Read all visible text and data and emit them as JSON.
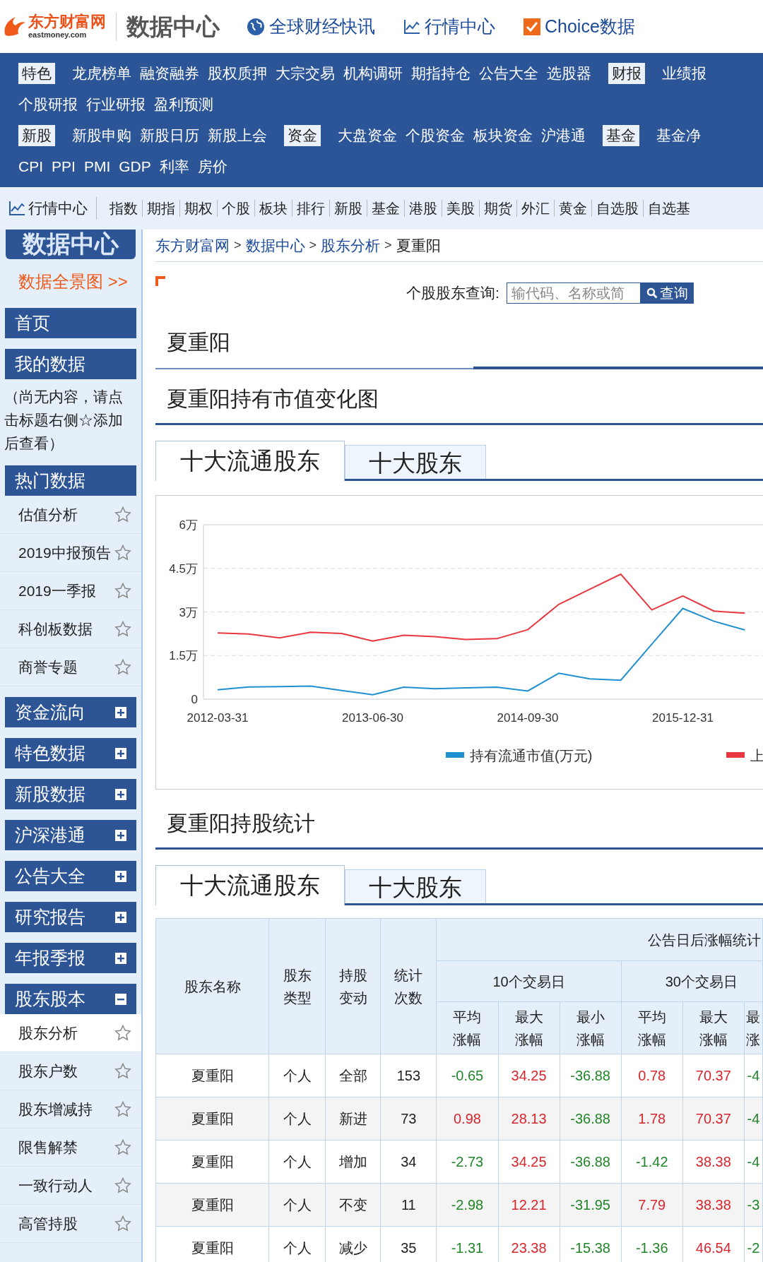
{
  "header": {
    "logo_text": "东方财富网",
    "logo_sub": "eastmoney.com",
    "title": "数据中心",
    "links": [
      {
        "kind": "globe",
        "text": "全球财经快讯"
      },
      {
        "kind": "chart",
        "text": "行情中心"
      },
      {
        "kind": "check",
        "text": "Choice数据"
      }
    ]
  },
  "nav": [
    {
      "items": [
        {
          "kind": "badge",
          "text": "特色"
        },
        {
          "kind": "link",
          "text": "龙虎榜单"
        },
        {
          "kind": "link",
          "text": "融资融券"
        },
        {
          "kind": "link",
          "text": "股权质押"
        },
        {
          "kind": "link",
          "text": "大宗交易"
        },
        {
          "kind": "link",
          "text": "机构调研"
        },
        {
          "kind": "link",
          "text": "期指持仓"
        },
        {
          "kind": "link",
          "text": "公告大全"
        },
        {
          "kind": "link",
          "text": "选股器"
        },
        {
          "kind": "badge",
          "text": "财报"
        },
        {
          "kind": "link",
          "text": "业绩报"
        }
      ]
    },
    {
      "items": [
        {
          "kind": "link",
          "text": "个股研报"
        },
        {
          "kind": "link",
          "text": "行业研报"
        },
        {
          "kind": "link",
          "text": "盈利预测"
        }
      ]
    },
    {
      "items": [
        {
          "kind": "badge",
          "text": "新股"
        },
        {
          "kind": "link",
          "text": "新股申购"
        },
        {
          "kind": "link",
          "text": "新股日历"
        },
        {
          "kind": "link",
          "text": "新股上会"
        },
        {
          "kind": "badge",
          "text": "资金"
        },
        {
          "kind": "link",
          "text": "大盘资金"
        },
        {
          "kind": "link",
          "text": "个股资金"
        },
        {
          "kind": "link",
          "text": "板块资金"
        },
        {
          "kind": "link",
          "text": "沪港通"
        },
        {
          "kind": "badge",
          "text": "基金"
        },
        {
          "kind": "link",
          "text": "基金净"
        }
      ]
    },
    {
      "items": [
        {
          "kind": "link",
          "text": "CPI"
        },
        {
          "kind": "link",
          "text": "PPI"
        },
        {
          "kind": "link",
          "text": "PMI"
        },
        {
          "kind": "link",
          "text": "GDP"
        },
        {
          "kind": "link",
          "text": "利率"
        },
        {
          "kind": "link",
          "text": "房价"
        }
      ]
    }
  ],
  "quote_bar": {
    "title": "行情中心",
    "items": [
      "指数",
      "期指",
      "期权",
      "个股",
      "板块",
      "排行",
      "新股",
      "基金",
      "港股",
      "美股",
      "期货",
      "外汇",
      "黄金",
      "自选股",
      "自选基"
    ]
  },
  "sidebar": {
    "logo": "数据中心",
    "overview_link": "数据全景图 >>",
    "menu": [
      {
        "kind": "header",
        "text": "首页"
      },
      {
        "kind": "header",
        "text": "我的数据"
      },
      {
        "kind": "note",
        "text": "（尚无内容，请点击标题右侧☆添加后查看）"
      },
      {
        "kind": "header",
        "text": "热门数据"
      },
      {
        "kind": "item",
        "text": "估值分析",
        "selected": false
      },
      {
        "kind": "item",
        "text": "2019中报预告",
        "selected": false
      },
      {
        "kind": "item",
        "text": "2019一季报",
        "selected": false
      },
      {
        "kind": "item",
        "text": "科创板数据",
        "selected": false
      },
      {
        "kind": "item",
        "text": "商誉专题",
        "selected": false
      },
      {
        "kind": "header",
        "text": "资金流向",
        "expanded": false
      },
      {
        "kind": "header",
        "text": "特色数据",
        "expanded": false
      },
      {
        "kind": "header",
        "text": "新股数据",
        "expanded": false
      },
      {
        "kind": "header",
        "text": "沪深港通",
        "expanded": false
      },
      {
        "kind": "header",
        "text": "公告大全",
        "expanded": false
      },
      {
        "kind": "header",
        "text": "研究报告",
        "expanded": false
      },
      {
        "kind": "header",
        "text": "年报季报",
        "expanded": false
      },
      {
        "kind": "header",
        "text": "股东股本",
        "expanded": true
      },
      {
        "kind": "item",
        "text": "股东分析",
        "selected": true
      },
      {
        "kind": "item",
        "text": "股东户数",
        "selected": false
      },
      {
        "kind": "item",
        "text": "股东增减持",
        "selected": false
      },
      {
        "kind": "item",
        "text": "限售解禁",
        "selected": false
      },
      {
        "kind": "item",
        "text": "一致行动人",
        "selected": false
      },
      {
        "kind": "item",
        "text": "高管持股",
        "selected": false
      }
    ]
  },
  "breadcrumb": {
    "separator": ">",
    "items": [
      {
        "kind": "link",
        "text": "东方财富网"
      },
      {
        "kind": "link",
        "text": "数据中心"
      },
      {
        "kind": "link",
        "text": "股东分析"
      },
      {
        "kind": "current",
        "text": "夏重阳"
      }
    ]
  },
  "search": {
    "label": "个股股东查询:",
    "placeholder": "输代码、名称或简",
    "button": "查询"
  },
  "title": "夏重阳",
  "chart_section": {
    "title": "夏重阳持有市值变化图",
    "tabs": [
      {
        "label": "十大流通股东",
        "selected": true
      },
      {
        "label": "十大股东",
        "selected": false
      }
    ],
    "chart_data": {
      "type": "line",
      "categories": [
        "2012-03-31",
        null,
        null,
        null,
        null,
        "2013-06-30",
        null,
        null,
        null,
        null,
        "2014-09-30",
        null,
        null,
        null,
        null,
        "2015-12-31",
        null,
        null
      ],
      "grid": true,
      "legend": true,
      "ylim": [
        0,
        6
      ],
      "yticks": [
        {
          "value": 0,
          "label": "0"
        },
        {
          "value": 1.5,
          "label": "1.5万"
        },
        {
          "value": 3,
          "label": "3万"
        },
        {
          "value": 4.5,
          "label": "4.5万"
        },
        {
          "value": 6,
          "label": "6万"
        }
      ],
      "series": [
        {
          "name": "持有流通市值(万元)",
          "color": "#1e90d0",
          "values": [
            0.32,
            0.42,
            0.43,
            0.45,
            0.3,
            0.15,
            0.41,
            0.36,
            0.39,
            0.41,
            0.28,
            0.89,
            0.7,
            0.65,
            1.89,
            3.12,
            2.68,
            2.38
          ]
        },
        {
          "name": "上",
          "color": "#e8373e",
          "values": [
            2.28,
            2.24,
            2.11,
            2.3,
            2.26,
            2.0,
            2.2,
            2.15,
            2.05,
            2.08,
            2.39,
            3.26,
            3.78,
            4.3,
            3.07,
            3.55,
            3.03,
            2.96
          ]
        }
      ]
    }
  },
  "stats_section": {
    "title": "夏重阳持股统计",
    "tabs": [
      {
        "label": "十大流通股东",
        "selected": true
      },
      {
        "label": "十大股东",
        "selected": false
      }
    ],
    "table": {
      "columns": [
        {
          "lines": [
            "股东名称"
          ]
        },
        {
          "lines": [
            "股东",
            "类型"
          ]
        },
        {
          "lines": [
            "持股",
            "变动"
          ]
        },
        {
          "lines": [
            "统计",
            "次数"
          ]
        }
      ],
      "group": "公告日后涨幅统计",
      "subgroups": [
        "10个交易日",
        "30个交易日"
      ],
      "subcolumns": [
        {
          "lines": [
            "平均",
            "涨幅"
          ]
        },
        {
          "lines": [
            "最大",
            "涨幅"
          ]
        },
        {
          "lines": [
            "最小",
            "涨幅"
          ]
        },
        {
          "lines": [
            "平均",
            "涨幅"
          ]
        },
        {
          "lines": [
            "最大",
            "涨幅"
          ]
        },
        {
          "lines": [
            "最",
            "涨"
          ]
        }
      ],
      "rows": [
        {
          "cells": [
            "夏重阳",
            "个人",
            "全部",
            "153"
          ],
          "stats": [
            {
              "text": "-0.65",
              "color": "#22862a"
            },
            {
              "text": "34.25",
              "color": "#d9262e"
            },
            {
              "text": "-36.88",
              "color": "#22862a"
            },
            {
              "text": "0.78",
              "color": "#d9262e"
            },
            {
              "text": "70.37",
              "color": "#d9262e"
            },
            {
              "text": "-4",
              "color": "#22862a"
            }
          ]
        },
        {
          "cells": [
            "夏重阳",
            "个人",
            "新进",
            "73"
          ],
          "stats": [
            {
              "text": "0.98",
              "color": "#d9262e"
            },
            {
              "text": "28.13",
              "color": "#d9262e"
            },
            {
              "text": "-36.88",
              "color": "#22862a"
            },
            {
              "text": "1.78",
              "color": "#d9262e"
            },
            {
              "text": "70.37",
              "color": "#d9262e"
            },
            {
              "text": "-4",
              "color": "#22862a"
            }
          ]
        },
        {
          "cells": [
            "夏重阳",
            "个人",
            "增加",
            "34"
          ],
          "stats": [
            {
              "text": "-2.73",
              "color": "#22862a"
            },
            {
              "text": "34.25",
              "color": "#d9262e"
            },
            {
              "text": "-36.88",
              "color": "#22862a"
            },
            {
              "text": "-1.42",
              "color": "#22862a"
            },
            {
              "text": "38.38",
              "color": "#d9262e"
            },
            {
              "text": "-4",
              "color": "#22862a"
            }
          ]
        },
        {
          "cells": [
            "夏重阳",
            "个人",
            "不变",
            "11"
          ],
          "stats": [
            {
              "text": "-2.98",
              "color": "#22862a"
            },
            {
              "text": "12.21",
              "color": "#d9262e"
            },
            {
              "text": "-31.95",
              "color": "#22862a"
            },
            {
              "text": "7.79",
              "color": "#d9262e"
            },
            {
              "text": "38.38",
              "color": "#d9262e"
            },
            {
              "text": "-3",
              "color": "#22862a"
            }
          ]
        },
        {
          "cells": [
            "夏重阳",
            "个人",
            "减少",
            "35"
          ],
          "stats": [
            {
              "text": "-1.31",
              "color": "#22862a"
            },
            {
              "text": "23.38",
              "color": "#d9262e"
            },
            {
              "text": "-15.38",
              "color": "#22862a"
            },
            {
              "text": "-1.36",
              "color": "#22862a"
            },
            {
              "text": "46.54",
              "color": "#d9262e"
            },
            {
              "text": "-2",
              "color": "#22862a"
            }
          ]
        }
      ]
    }
  }
}
